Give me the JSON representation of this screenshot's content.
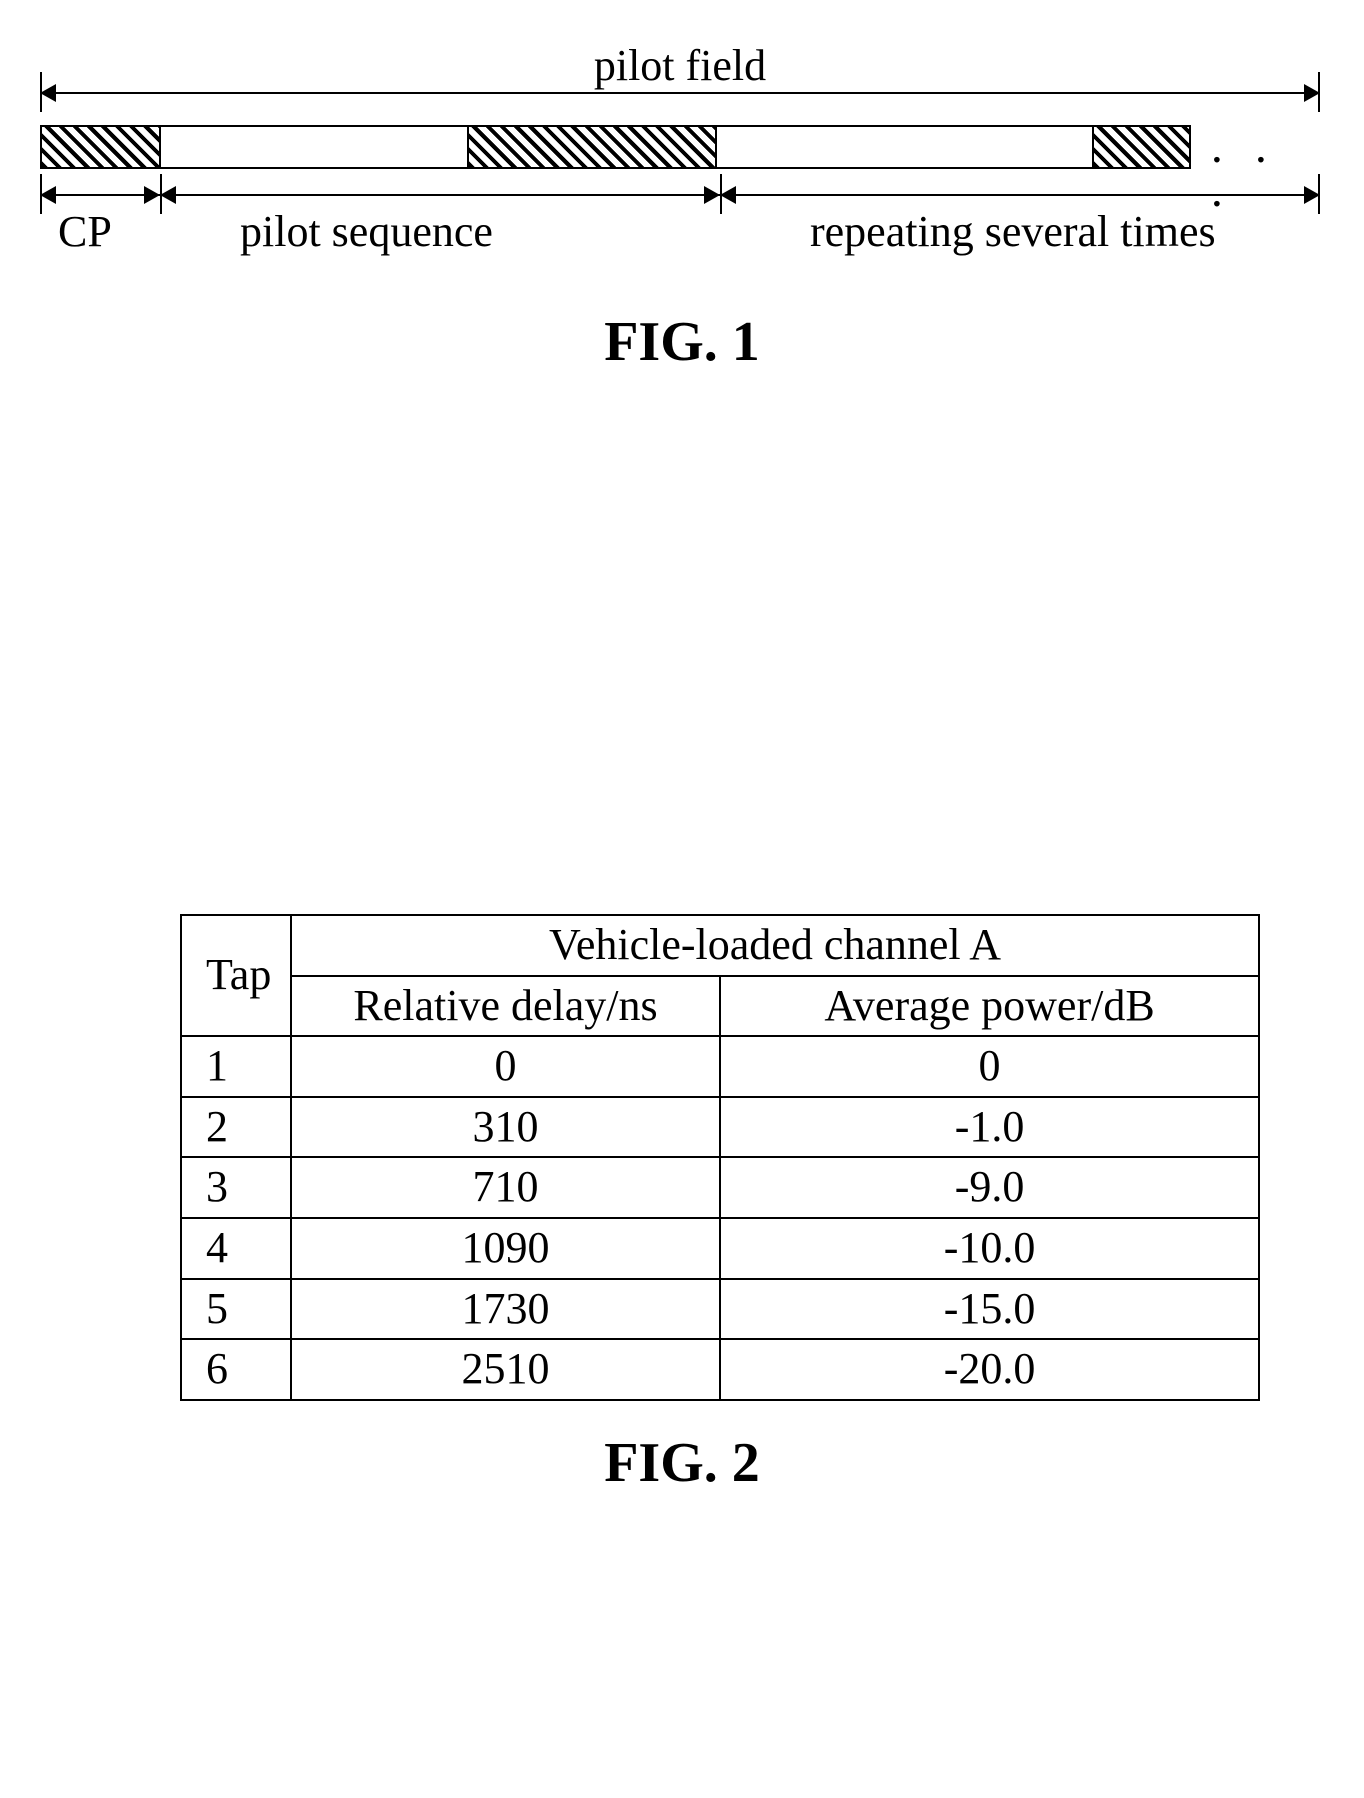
{
  "fig1": {
    "top_label": "pilot field",
    "bottom_labels": {
      "cp": "CP",
      "pilot_seq": "pilot sequence",
      "repeating": "repeating several times"
    },
    "caption": "FIG. 1",
    "ellipsis": ". . ."
  },
  "fig2": {
    "caption": "FIG. 2",
    "header_span": "Vehicle-loaded channel A",
    "header_tap": "Tap",
    "header_delay": "Relative delay/ns",
    "header_power": "Average power/dB"
  },
  "chart_data": {
    "type": "table",
    "title": "Vehicle-loaded channel A",
    "columns": [
      "Tap",
      "Relative delay/ns",
      "Average power/dB"
    ],
    "rows": [
      {
        "tap": 1,
        "delay_ns": 0,
        "power_db": 0
      },
      {
        "tap": 2,
        "delay_ns": 310,
        "power_db": -1.0
      },
      {
        "tap": 3,
        "delay_ns": 710,
        "power_db": -9.0
      },
      {
        "tap": 4,
        "delay_ns": 1090,
        "power_db": -10.0
      },
      {
        "tap": 5,
        "delay_ns": 1730,
        "power_db": -15.0
      },
      {
        "tap": 6,
        "delay_ns": 2510,
        "power_db": -20.0
      }
    ],
    "display_rows": [
      [
        "1",
        "0",
        "0"
      ],
      [
        "2",
        "310",
        "-1.0"
      ],
      [
        "3",
        "710",
        "-9.0"
      ],
      [
        "4",
        "1090",
        "-10.0"
      ],
      [
        "5",
        "1730",
        "-15.0"
      ],
      [
        "6",
        "2510",
        "-20.0"
      ]
    ]
  }
}
